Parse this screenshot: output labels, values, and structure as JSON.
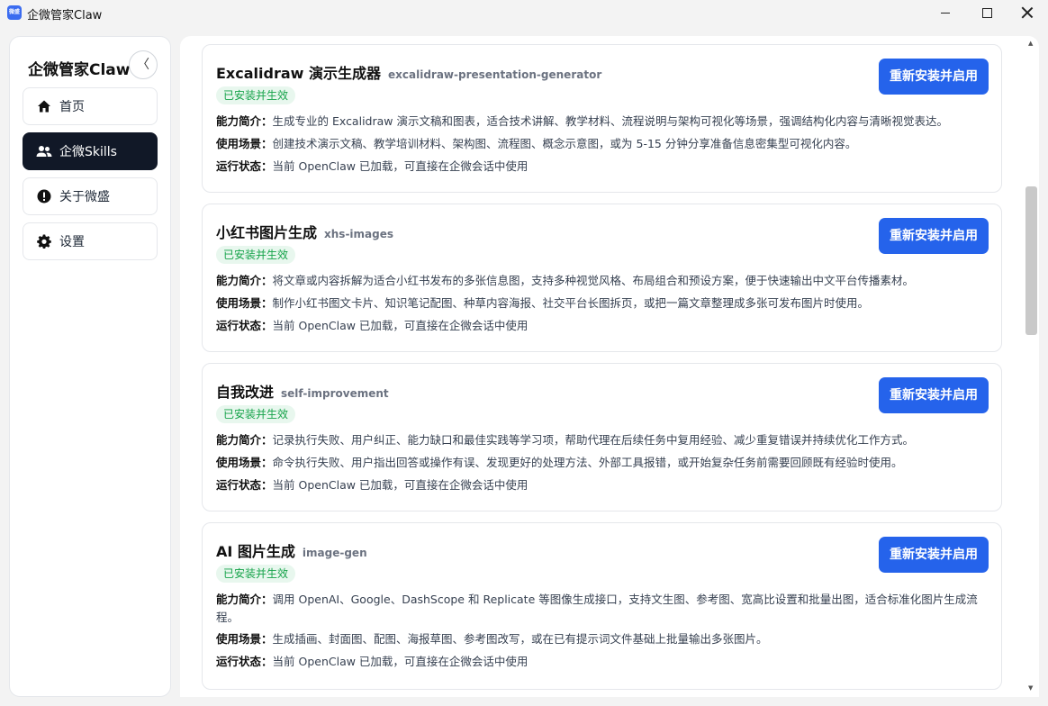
{
  "window": {
    "title": "企微管家Claw",
    "icon_text": "微盛"
  },
  "sidebar": {
    "brand": "企微管家Claw",
    "collapse_glyph": "〈",
    "items": [
      {
        "label": "首页",
        "icon": "home-icon"
      },
      {
        "label": "企微Skills",
        "icon": "users-icon"
      },
      {
        "label": "关于微盛",
        "icon": "info-icon"
      },
      {
        "label": "设置",
        "icon": "gear-icon"
      }
    ]
  },
  "labels": {
    "ability": "能力简介：",
    "scene": "使用场景：",
    "status": "运行状态："
  },
  "cards": [
    {
      "title": "Excalidraw 演示生成器",
      "slug": "excalidraw-presentation-generator",
      "badge": "已安装并生效",
      "button": "重新安装并启用",
      "ability": "生成专业的 Excalidraw 演示文稿和图表，适合技术讲解、教学材料、流程说明与架构可视化等场景，强调结构化内容与清晰视觉表达。",
      "scene": "创建技术演示文稿、教学培训材料、架构图、流程图、概念示意图，或为 5-15 分钟分享准备信息密集型可视化内容。",
      "status": "当前 OpenClaw 已加载，可直接在企微会话中使用"
    },
    {
      "title": "小红书图片生成",
      "slug": "xhs-images",
      "badge": "已安装并生效",
      "button": "重新安装并启用",
      "ability": "将文章或内容拆解为适合小红书发布的多张信息图，支持多种视觉风格、布局组合和预设方案，便于快速输出中文平台传播素材。",
      "scene": "制作小红书图文卡片、知识笔记配图、种草内容海报、社交平台长图拆页，或把一篇文章整理成多张可发布图片时使用。",
      "status": "当前 OpenClaw 已加载，可直接在企微会话中使用"
    },
    {
      "title": "自我改进",
      "slug": "self-improvement",
      "badge": "已安装并生效",
      "button": "重新安装并启用",
      "ability": "记录执行失败、用户纠正、能力缺口和最佳实践等学习项，帮助代理在后续任务中复用经验、减少重复错误并持续优化工作方式。",
      "scene": "命令执行失败、用户指出回答或操作有误、发现更好的处理方法、外部工具报错，或开始复杂任务前需要回顾既有经验时使用。",
      "status": "当前 OpenClaw 已加载，可直接在企微会话中使用"
    },
    {
      "title": "AI 图片生成",
      "slug": "image-gen",
      "badge": "已安装并生效",
      "button": "重新安装并启用",
      "ability": "调用 OpenAI、Google、DashScope 和 Replicate 等图像生成接口，支持文生图、参考图、宽高比设置和批量出图，适合标准化图片生成流程。",
      "scene": "生成插画、封面图、配图、海报草图、参考图改写，或在已有提示词文件基础上批量输出多张图片。",
      "status": "当前 OpenClaw 已加载，可直接在企微会话中使用"
    }
  ]
}
